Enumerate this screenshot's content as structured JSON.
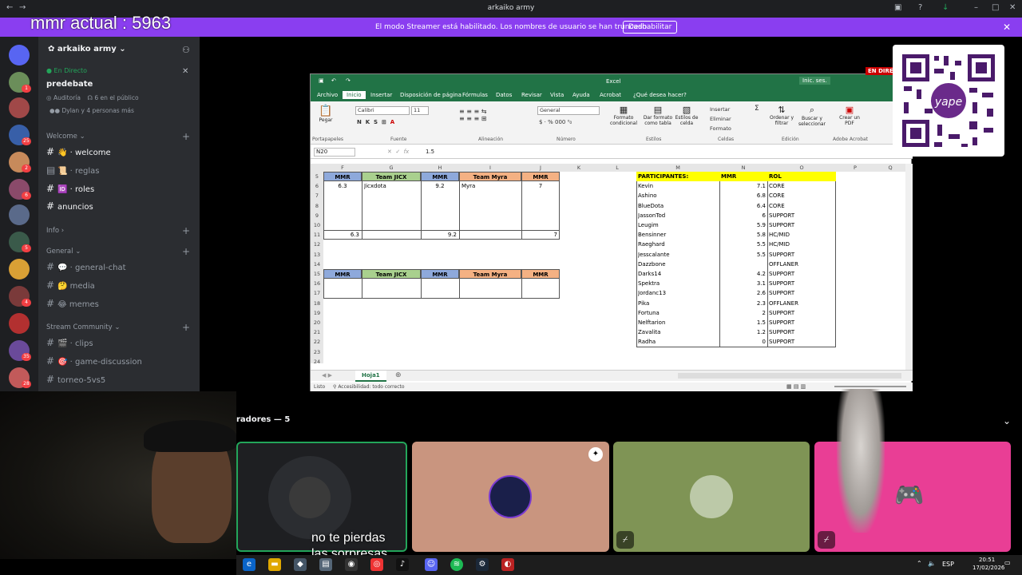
{
  "titlebar": {
    "title": "arkaiko army"
  },
  "overlay": {
    "mmr": "mmr actual : 5963"
  },
  "banner": {
    "text": "El modo Streamer está habilitado. Los nombres de usuario se han truncado.",
    "button": "Deshabilitar"
  },
  "rail": {
    "badges": [
      "1",
      "25",
      "2",
      "6",
      "5",
      "4",
      "35",
      "28"
    ]
  },
  "sidebar": {
    "server": "arkaiko army",
    "live": {
      "status": "En Directo",
      "title": "predebate",
      "audience": "Auditoría",
      "count": "6 en el público",
      "people": "Dylan y 4 personas más"
    },
    "categories": {
      "welcome": "Welcome",
      "info": "Info",
      "general": "General",
      "stream": "Stream Community"
    },
    "channels": {
      "welcome": "welcome",
      "reglas": "reglas",
      "roles": "roles",
      "anuncios": "anuncios",
      "general_chat": "general-chat",
      "media": "media",
      "memes": "memes",
      "clips": "clips",
      "game_discussion": "game-discussion",
      "torneo": "torneo-5vs5"
    }
  },
  "excel": {
    "title": "Excel",
    "signin": "Inic. ses.",
    "tabs": [
      "Archivo",
      "Inicio",
      "Insertar",
      "Disposición de página",
      "Fórmulas",
      "Datos",
      "Revisar",
      "Vista",
      "Ayuda",
      "Acrobat",
      "¿Qué desea hacer?"
    ],
    "ribbon": {
      "paste": "Pegar",
      "font": "Calibri",
      "size": "11",
      "number_format": "General",
      "groups": [
        "Portapapeles",
        "Fuente",
        "Alineación",
        "Número",
        "Estilos",
        "Celdas",
        "Edición",
        "Adobe Acrobat"
      ],
      "buttons": [
        "Formato condicional",
        "Dar formato como tabla",
        "Estilos de celda",
        "Insertar",
        "Eliminar",
        "Formato",
        "Ordenar y filtrar",
        "Buscar y seleccionar",
        "Crear un PDF"
      ]
    },
    "namebox": "N20",
    "formula": "1.5",
    "columns": [
      "F",
      "G",
      "H",
      "I",
      "J",
      "K",
      "L",
      "M",
      "N",
      "O",
      "P",
      "Q"
    ],
    "rows": [
      "5",
      "6",
      "7",
      "8",
      "9",
      "10",
      "11",
      "12",
      "13",
      "14",
      "15",
      "16",
      "17",
      "18",
      "19",
      "20",
      "21",
      "22",
      "23",
      "24"
    ],
    "teams": {
      "mmr": "MMR",
      "team1": "Team JICX",
      "team2": "Team Myra",
      "r6": [
        "6.3",
        "Jicxdota",
        "9.2",
        "Myra",
        "7"
      ],
      "totals": [
        "6.3",
        "9.2",
        "7"
      ]
    },
    "participants_header": [
      "PARTICIPANTES:",
      "MMR",
      "ROL"
    ],
    "participants": [
      [
        "Kevin",
        "7.1",
        "CORE"
      ],
      [
        "Ashino",
        "6.8",
        "CORE"
      ],
      [
        "BlueDota",
        "6.4",
        "CORE"
      ],
      [
        "JassonTod",
        "6",
        "SUPPORT"
      ],
      [
        "Leugim",
        "5.9",
        "SUPPORT"
      ],
      [
        "Bensinner",
        "5.8",
        "HC/MID"
      ],
      [
        "Raeghard",
        "5.5",
        "HC/MID"
      ],
      [
        "Jesscalante",
        "5.5",
        "SUPPORT"
      ],
      [
        "Dazzbone",
        "",
        "OFFLANER"
      ],
      [
        "Darks14",
        "4.2",
        "SUPPORT"
      ],
      [
        "Spektra",
        "3.1",
        "SUPPORT"
      ],
      [
        "Jordanc13",
        "2.6",
        "SUPPORT"
      ],
      [
        "Pika",
        "2.3",
        "OFFLANER"
      ],
      [
        "Fortuna",
        "2",
        "SUPPORT"
      ],
      [
        "Nelftarion",
        "1.5",
        "SUPPORT"
      ],
      [
        "Zavalita",
        "1.2",
        "SUPPORT"
      ],
      [
        "Radha",
        "0",
        "SUPPORT"
      ]
    ],
    "sheet": "Hoja1",
    "status": {
      "ready": "Listo",
      "access": "Accesibilidad: todo correcto"
    }
  },
  "stream_badge": "EN DIRE",
  "voice": {
    "header": "radores — 5"
  },
  "caption": {
    "line1": "no te pierdas",
    "line2": "las sorpresas"
  },
  "taskbar": {
    "lang": "ESP",
    "time": "20:51",
    "date": "17/02/2026"
  },
  "colors": {
    "purple": "#8a3ef0",
    "excel_green": "#217346",
    "yellow": "#ffff00",
    "blue_hdr": "#8ea9db",
    "green_hdr": "#a9d08e",
    "orange_hdr": "#f4b183",
    "tile_tan": "#c9957f",
    "tile_olive": "#7f9455",
    "tile_pink": "#e93e95"
  }
}
